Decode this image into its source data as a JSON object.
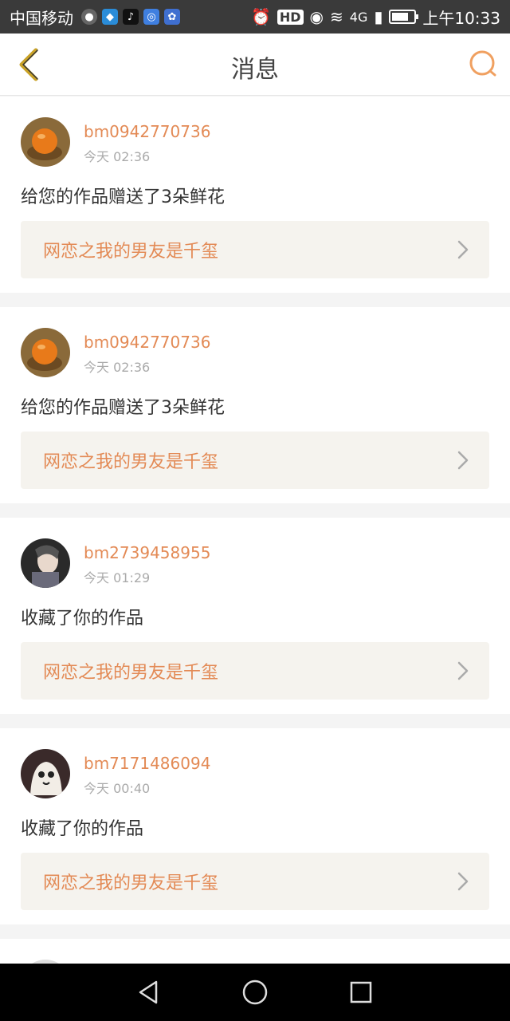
{
  "status_bar": {
    "carrier": "中国移动",
    "network": "4G",
    "time": "上午10:33",
    "hd_label": "HD",
    "battery_level": 0.75
  },
  "header": {
    "title": "消息"
  },
  "messages": [
    {
      "username": "bm0942770736",
      "time": "今天 02:36",
      "action": "给您的作品赠送了3朵鲜花",
      "work_title": "网恋之我的男友是千玺"
    },
    {
      "username": "bm0942770736",
      "time": "今天 02:36",
      "action": "给您的作品赠送了3朵鲜花",
      "work_title": "网恋之我的男友是千玺"
    },
    {
      "username": "bm2739458955",
      "time": "今天 01:29",
      "action": "收藏了你的作品",
      "work_title": "网恋之我的男友是千玺"
    },
    {
      "username": "bm7171486094",
      "time": "今天 00:40",
      "action": "收藏了你的作品",
      "work_title": "网恋之我的男友是千玺"
    }
  ],
  "colors": {
    "accent": "#e38a55",
    "back_icon": "#c9a227"
  },
  "icons": [
    "back-chevron-icon",
    "search-icon",
    "chevron-right-icon",
    "nav-back-icon",
    "nav-home-icon",
    "nav-recents-icon"
  ]
}
